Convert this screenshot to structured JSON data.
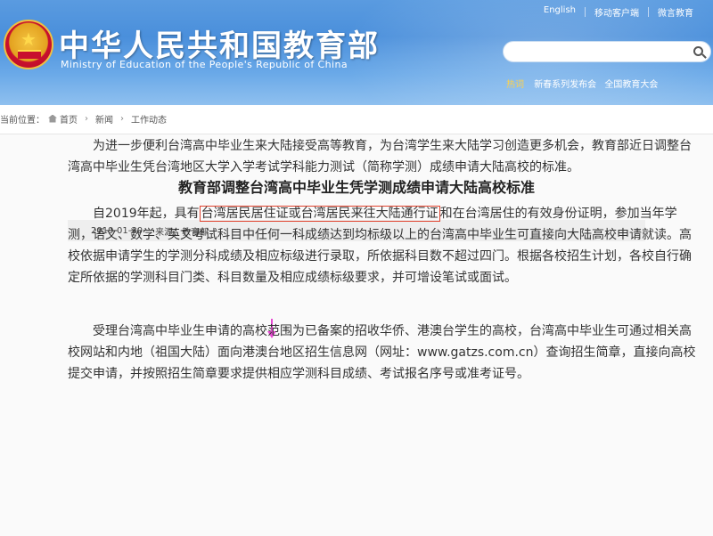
{
  "header": {
    "title": "中华人民共和国教育部",
    "subtitle": "Ministry of Education of the People's Republic of China",
    "toplinks": [
      "English",
      "移动客户端",
      "微言教育"
    ],
    "search": {
      "placeholder": ""
    },
    "hot_label": "热词",
    "hot_items": [
      "新春系列发布会",
      "全国教育大会"
    ]
  },
  "breadcrumb": {
    "prefix": "当前位置：",
    "items": [
      "首页",
      "新闻",
      "工作动态"
    ]
  },
  "article": {
    "title": "教育部调整台湾高中毕业生凭学测成绩申请大陆高校标准",
    "date": "2019-01-30",
    "source": "来源：教育部",
    "p1": [
      "为进一步便利台湾高中毕业生来大陆接受高等教育，为台湾学生来大陆学习创造更多机会，教育部近日调整台",
      "湾高中毕业生凭台湾地区大学入学考试学科能力测试（简称学测）成绩申请大陆高校的标准。"
    ],
    "p2_first_before": "自2019年起，具有",
    "p2_highlight": "台湾居民居住证或台湾居民来往大陆通行证",
    "p2_first_after": "和在台湾居住的有效身份证明，参加当年学",
    "p2_rest": [
      "测，语文、数学、英文考试科目中任何一科成绩达到均标级以上的台湾高中毕业生可直接向大陆高校申请就读。高",
      "校依据申请学生的学测分科成绩及相应标级进行录取，所依据科目数不超过四门。根据各校招生计划，各校自行确",
      "定所依据的学测科目门类、科目数量及相应成绩标级要求，并可增设笔试或面试。"
    ],
    "p3": [
      "受理台湾高中毕业生申请的高校范围为已备案的招收华侨、港澳台学生的高校，台湾高中毕业生可通过相关高",
      "校网站和内地（祖国大陆）面向港澳台地区招生信息网（网址：www.gatzs.com.cn）查询招生简章，直接向高校",
      "提交申请，并按照招生简章要求提供相应学测科目成绩、考试报名序号或准考证号。"
    ]
  },
  "colors": {
    "header_blue": "#4a8fdb",
    "highlight_border": "#e0432e",
    "annotation_arrow": "#e84bd4"
  }
}
